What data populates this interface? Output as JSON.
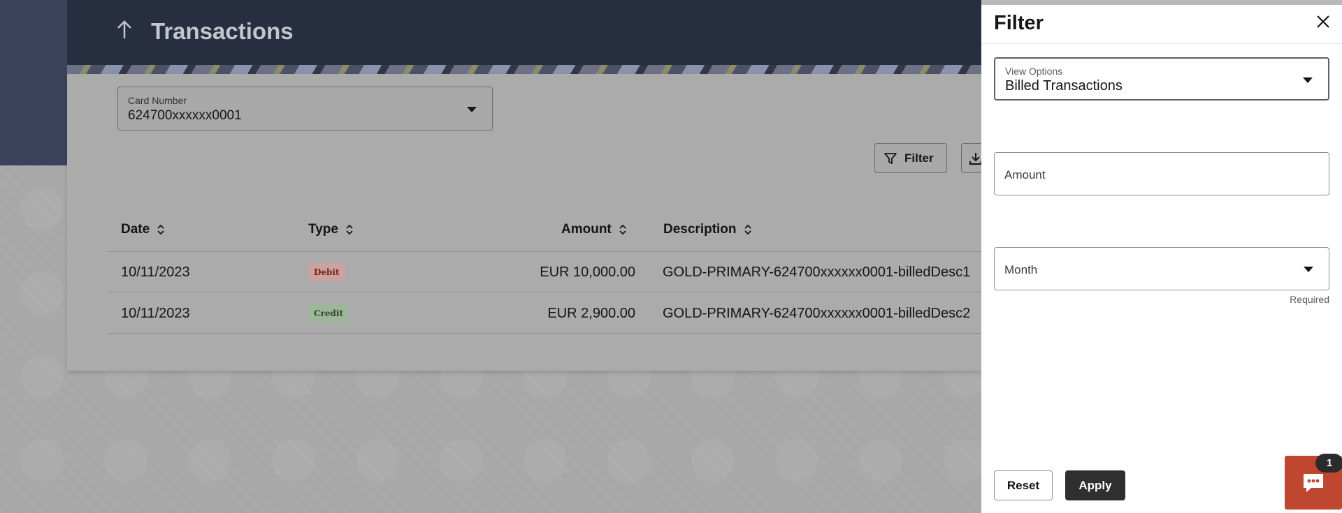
{
  "header": {
    "title": "Transactions"
  },
  "card_selector": {
    "label": "Card Number",
    "value": "624700xxxxxx0001"
  },
  "toolbar": {
    "filter_label": "Filter"
  },
  "table": {
    "columns": [
      "Date",
      "Type",
      "Amount",
      "Description"
    ],
    "rows": [
      {
        "date": "10/11/2023",
        "type": "Debit",
        "amount": "EUR 10,000.00",
        "description": "GOLD-PRIMARY-624700xxxxxx0001-billedDesc1"
      },
      {
        "date": "10/11/2023",
        "type": "Credit",
        "amount": "EUR 2,900.00",
        "description": "GOLD-PRIMARY-624700xxxxxx0001-billedDesc2"
      }
    ]
  },
  "filter_panel": {
    "title": "Filter",
    "view_options": {
      "label": "View Options",
      "value": "Billed Transactions"
    },
    "amount": {
      "placeholder": "Amount"
    },
    "month": {
      "placeholder": "Month",
      "hint": "Required"
    },
    "reset_label": "Reset",
    "apply_label": "Apply"
  },
  "chat": {
    "badge_count": "1"
  },
  "colors": {
    "header": "#272e40",
    "apply": "#2f2f2f",
    "chat": "#c0472f",
    "debit": "#7e1f1a",
    "credit": "#2c4a23"
  }
}
